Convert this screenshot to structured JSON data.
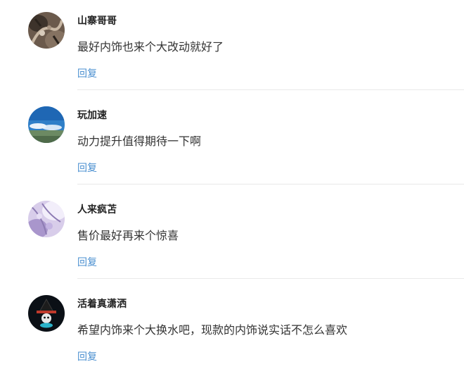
{
  "comments": [
    {
      "username": "山寨哥哥",
      "content": "最好内饰也来个大改动就好了",
      "reply_label": "回复",
      "avatar_icon": "gecko-photo-avatar"
    },
    {
      "username": "玩加速",
      "content": "动力提升值得期待一下啊",
      "reply_label": "回复",
      "avatar_icon": "sky-landscape-avatar"
    },
    {
      "username": "人来疯苫",
      "content": "售价最好再来个惊喜",
      "reply_label": "回复",
      "avatar_icon": "purple-blossom-avatar"
    },
    {
      "username": "活着真潇洒",
      "content": "希望内饰来个大换水吧，现款的内饰说实话不怎么喜欢",
      "reply_label": "回复",
      "avatar_icon": "witch-hat-cartoon-avatar"
    }
  ],
  "colors": {
    "reply_link": "#4a8fd0",
    "divider": "#e9e9e9"
  }
}
